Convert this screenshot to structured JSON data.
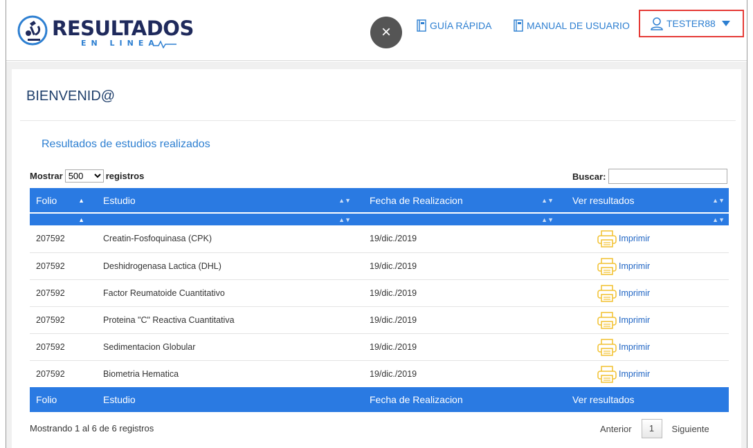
{
  "header": {
    "logo_title": "RESULTADOS",
    "logo_subtitle": "EN LINEA",
    "close_label": "×",
    "guide_label": "GUÍA RÁPIDA",
    "manual_label": "MANUAL DE USUARIO",
    "user_label": "TESTER88"
  },
  "main": {
    "welcome": "BIENVENID@",
    "subtitle": "Resultados de estudios realizados",
    "length_prefix": "Mostrar",
    "length_value": "500",
    "length_suffix": "registros",
    "search_label": "Buscar:",
    "search_value": ""
  },
  "table": {
    "columns": [
      "Folio",
      "Estudio",
      "Fecha de Realizacion",
      "Ver resultados"
    ],
    "rows": [
      {
        "folio": "207592",
        "estudio": "Creatin-Fosfoquinasa (CPK)",
        "fecha": "19/dic./2019",
        "accion": "Imprimir"
      },
      {
        "folio": "207592",
        "estudio": "Deshidrogenasa Lactica (DHL)",
        "fecha": "19/dic./2019",
        "accion": "Imprimir"
      },
      {
        "folio": "207592",
        "estudio": "Factor Reumatoide Cuantitativo",
        "fecha": "19/dic./2019",
        "accion": "Imprimir"
      },
      {
        "folio": "207592",
        "estudio": "Proteina \"C\" Reactiva Cuantitativa",
        "fecha": "19/dic./2019",
        "accion": "Imprimir"
      },
      {
        "folio": "207592",
        "estudio": "Sedimentacion Globular",
        "fecha": "19/dic./2019",
        "accion": "Imprimir"
      },
      {
        "folio": "207592",
        "estudio": "Biometria Hematica",
        "fecha": "19/dic./2019",
        "accion": "Imprimir"
      }
    ],
    "info": "Mostrando 1 al 6 de 6 registros",
    "pager": {
      "prev": "Anterior",
      "page": "1",
      "next": "Siguiente"
    }
  },
  "colors": {
    "accent": "#2a7ae2",
    "brand_dark": "#1f2a5c",
    "link": "#2d7fd1",
    "highlight_border": "#e53935",
    "print_icon": "#f2c12e"
  }
}
